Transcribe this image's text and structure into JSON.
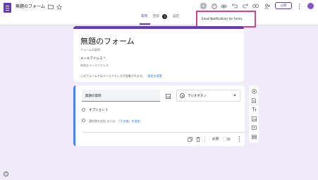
{
  "app": {
    "doc_title": "無題のフォーム"
  },
  "header": {
    "tabs": [
      {
        "label": "質問"
      },
      {
        "label": "回答"
      },
      {
        "label": "設定"
      }
    ],
    "responses_count": "3",
    "publish_label": "公開",
    "tooltip": "Email Notifications for Forms"
  },
  "form": {
    "title": "無題のフォーム",
    "description_placeholder": "フォームの説明",
    "email_label": "メールアドレス *",
    "email_placeholder": "有効なメールアドレス",
    "email_notice": "このフォームではメールアドレスが収集されます。",
    "email_notice_link": "設定を変更"
  },
  "question": {
    "title": "無題の質問",
    "type": "ラジオボタン",
    "option1": "オプション 1",
    "add_option": "選択肢を追加 または",
    "add_other": "「その他」を追加",
    "required_label": "必須"
  },
  "side_tools": [
    {
      "icon": "add-question-icon"
    },
    {
      "icon": "import-questions-icon"
    },
    {
      "icon": "title-text-icon"
    },
    {
      "icon": "image-icon"
    },
    {
      "icon": "video-icon"
    },
    {
      "icon": "section-icon"
    }
  ],
  "colors": {
    "accent": "#673ab7",
    "highlight": "#d63f8c",
    "background": "#f0ebf8",
    "question_border": "#4285f4"
  }
}
